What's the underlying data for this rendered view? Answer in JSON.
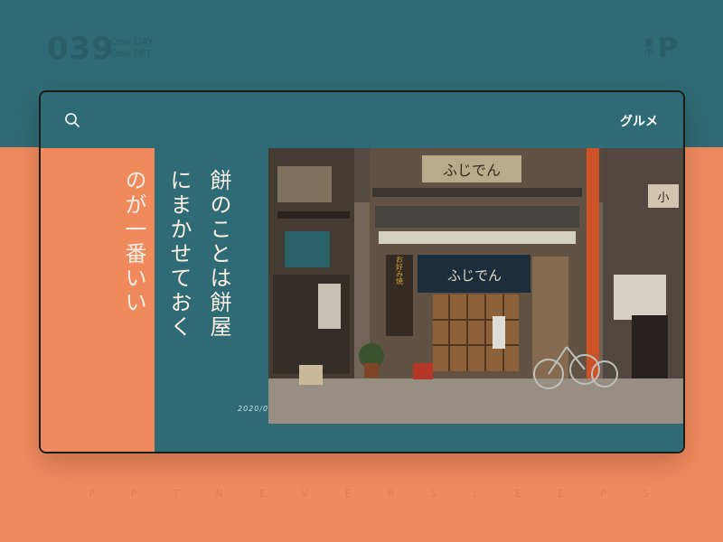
{
  "header": {
    "number": "039",
    "sub_line_1": "One DAY",
    "sub_line_2": "One PPT",
    "logo_small": "爱个",
    "logo_big": "P"
  },
  "card": {
    "category": "グルメ",
    "lines": [
      "餅のことは餅屋",
      "にまかせておく",
      "のが一番いい"
    ],
    "date": "2020/03/05"
  },
  "photo": {
    "sign_top": "ふじでん",
    "sign_noren": "ふじでん",
    "sign_left": "お好み焼",
    "sign_side": "小"
  },
  "footer": {
    "letters": [
      "P",
      "P",
      "T",
      "N",
      "E",
      "V",
      "E",
      "R",
      "S",
      "L",
      "E",
      "E",
      "P",
      "S"
    ]
  },
  "colors": {
    "teal": "#2f6b74",
    "coral": "#f08a5d"
  }
}
